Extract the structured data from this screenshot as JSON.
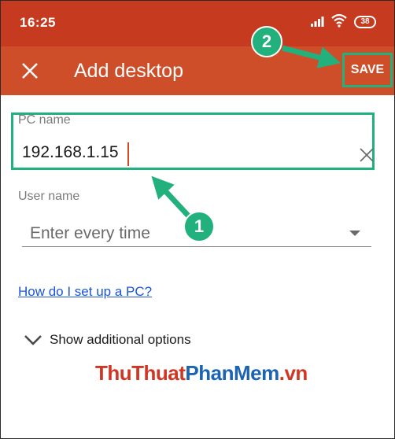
{
  "status_bar": {
    "time": "16:25",
    "battery": "38"
  },
  "app_bar": {
    "title": "Add desktop",
    "save_label": "SAVE"
  },
  "form": {
    "pc_name": {
      "label": "PC name",
      "value": "192.168.1.15"
    },
    "user_name": {
      "label": "User name",
      "value": "Enter every time"
    },
    "help_link": "How do I set up a PC?",
    "additional_options": "Show additional options"
  },
  "watermark": {
    "part1": "ThuThuat",
    "part2": "PhanMem",
    "part3": ".vn"
  },
  "annotations": {
    "step1": "1",
    "step2": "2"
  },
  "colors": {
    "status_bar": "#c63b20",
    "app_bar": "#cf4e2a",
    "annotation": "#22b07d",
    "link": "#1a56d6"
  }
}
